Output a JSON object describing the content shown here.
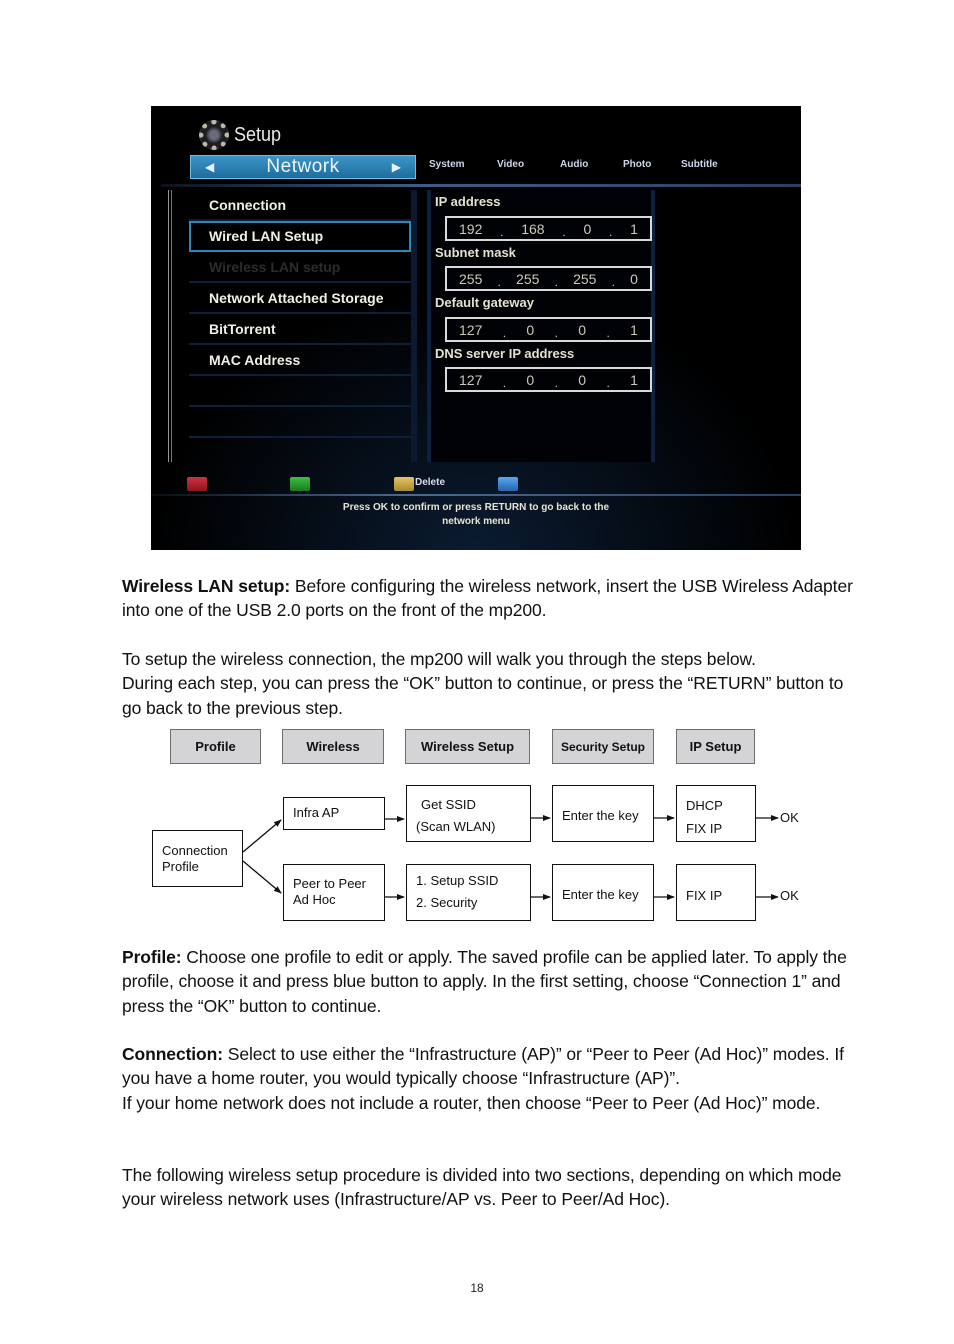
{
  "tv_screen": {
    "title": "Setup",
    "category": "Network",
    "tabs": [
      "System",
      "Video",
      "Audio",
      "Photo",
      "Subtitle"
    ],
    "menu_items": [
      {
        "label": "Connection",
        "state": "normal"
      },
      {
        "label": "Wired LAN Setup",
        "state": "selected"
      },
      {
        "label": "Wireless LAN setup",
        "state": "disabled"
      },
      {
        "label": "Network Attached Storage",
        "state": "normal"
      },
      {
        "label": "BitTorrent",
        "state": "normal"
      },
      {
        "label": "MAC Address",
        "state": "normal"
      },
      {
        "label": "",
        "state": "normal"
      },
      {
        "label": "",
        "state": "normal"
      }
    ],
    "fields": [
      {
        "label": "IP address",
        "octets": [
          "192",
          "168",
          "0",
          "1"
        ]
      },
      {
        "label": "Subnet mask",
        "octets": [
          "255",
          "255",
          "255",
          "0"
        ]
      },
      {
        "label": "Default gateway",
        "octets": [
          "127",
          "0",
          "0",
          "1"
        ]
      },
      {
        "label": "DNS server IP address",
        "octets": [
          "127",
          "0",
          "0",
          "1"
        ]
      }
    ],
    "color_buttons": [
      {
        "color": "red",
        "label": ""
      },
      {
        "color": "green",
        "label": ""
      },
      {
        "color": "yellow",
        "label": "Delete"
      },
      {
        "color": "blue",
        "label": ""
      }
    ],
    "hint_line1": "Press OK to confirm or press RETURN to go back to the",
    "hint_line2": "network menu"
  },
  "intro": {
    "wireless_heading": "Wireless LAN setup:",
    "wireless_text": " Before configuring the wireless network, insert the USB Wireless Adapter into one of the USB 2.0 ports on the front of the mp200.",
    "steps_text_1": "To setup the wireless connection, the mp200 will walk you through the steps below.",
    "steps_text_2": "During each step, you can press the “OK” button to continue, or press the “RETURN” button to go back to the previous step."
  },
  "diagram": {
    "headers": [
      "Profile",
      "Wireless",
      "Wireless Setup",
      "Security Setup",
      "IP Setup"
    ],
    "start": [
      "Connection",
      "Profile"
    ],
    "infra_row": {
      "mode": [
        "Infra AP"
      ],
      "wireless_setup": [
        "Get SSID",
        "(Scan WLAN)"
      ],
      "security": [
        "Enter the key"
      ],
      "ip": [
        "DHCP",
        "FIX IP"
      ],
      "result": "OK"
    },
    "adhoc_row": {
      "mode": [
        "Peer to Peer",
        "Ad Hoc"
      ],
      "wireless_setup": [
        "1. Setup SSID",
        "2. Security"
      ],
      "security": [
        "Enter the key"
      ],
      "ip": [
        "FIX IP"
      ],
      "result": "OK"
    }
  },
  "sections": {
    "profile_heading": "Profile:",
    "profile_text": " Choose one profile to edit or apply. The saved profile can be applied later. To apply the profile, choose it and press blue button to apply. In the first setting, choose “Connection 1” and press the “OK” button to continue.",
    "connection_heading": "Connection:",
    "connection_text": " Select to use either the “Infrastructure (AP)” or “Peer to Peer (Ad Hoc)” modes. If you have a home router, you would typically choose “Infrastructure (AP)”.",
    "connection_text_2": "If your home network does not include a router, then choose “Peer to Peer (Ad Hoc)” mode.",
    "closing_text": "The following wireless setup procedure is divided into two sections, depending on which mode your wireless network uses (Infrastructure/AP vs. Peer to Peer/Ad Hoc)."
  },
  "page_number": "18"
}
